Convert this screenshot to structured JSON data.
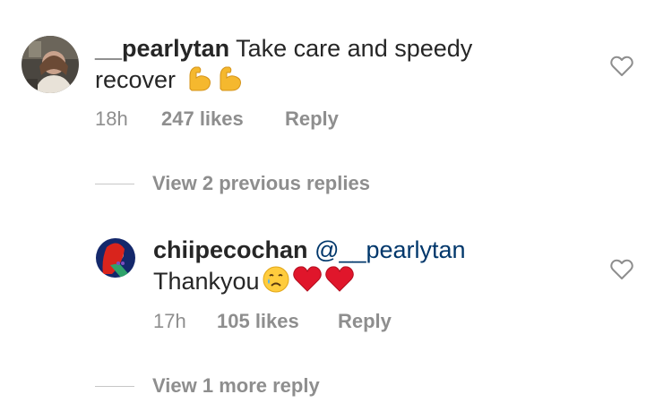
{
  "comments": [
    {
      "username": "__pearlytan",
      "text": "Take care and speedy",
      "text_line2": "recover",
      "emojis": [
        "flexed-biceps",
        "flexed-biceps"
      ],
      "time": "18h",
      "likes": "247 likes",
      "reply_label": "Reply",
      "view_replies": "View 2 previous replies"
    },
    {
      "username": "chiipecochan",
      "mention": "@__pearlytan",
      "text": "Thankyou",
      "emojis": [
        "crying-face",
        "red-heart",
        "red-heart"
      ],
      "time": "17h",
      "likes": "105 likes",
      "reply_label": "Reply",
      "view_replies": "View 1 more reply"
    }
  ],
  "colors": {
    "text": "#262626",
    "muted": "#8e8e8e",
    "mention": "#00376b",
    "heart_emoji": "#e0162b",
    "biceps_emoji": "#f5b82e"
  }
}
